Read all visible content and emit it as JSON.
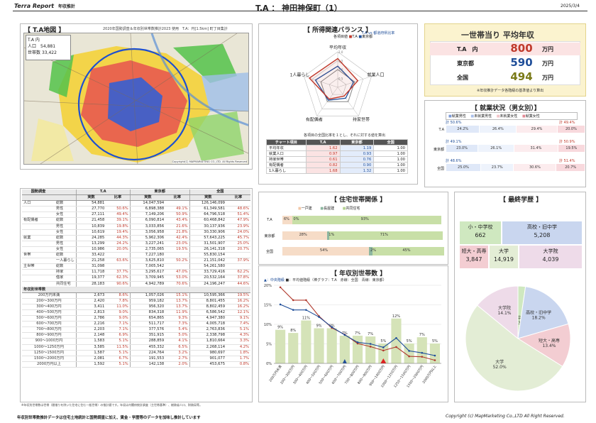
{
  "header": {
    "brand": "Terra Report",
    "brand_sub": "年収推計",
    "title": "T.A ： 神田神保町（1）",
    "date": "2025/3/4"
  },
  "map": {
    "title": "【 T.A地図 】",
    "source": "2020年国勢調査＆年収別世帯数推計2023 使用　T.A：円[1.5km] 町丁目集計",
    "info_title": "T.A 内",
    "pop_label": "人口",
    "pop_value": "54,881",
    "hh_label": "世帯数",
    "hh_value": "33,422",
    "copyright": "Copyright(C) MAPMARKETING CO.,LTD. All Rights Reserved"
  },
  "stats": {
    "head": [
      "国勢調査",
      "T.A",
      "東京都",
      "全国"
    ],
    "sub": [
      "実数",
      "比率",
      "実数",
      "比率",
      "実数",
      "比率"
    ],
    "rows": [
      [
        "人口",
        "総数",
        "54,881",
        "",
        "14,047,594",
        "",
        "126,146,099",
        ""
      ],
      [
        "",
        "男性",
        "27,770",
        "50.6%",
        "6,898,388",
        "49.1%",
        "61,349,581",
        "48.6%"
      ],
      [
        "",
        "女性",
        "27,111",
        "49.4%",
        "7,149,206",
        "50.9%",
        "64,796,518",
        "51.4%"
      ],
      [
        "有配偶者",
        "総数",
        "21,458",
        "39.1%",
        "6,090,814",
        "43.4%",
        "60,468,842",
        "47.9%"
      ],
      [
        "",
        "男性",
        "10,839",
        "19.8%",
        "3,033,856",
        "21.6%",
        "30,137,936",
        "23.9%"
      ],
      [
        "",
        "女性",
        "10,619",
        "19.4%",
        "3,056,958",
        "21.8%",
        "30,330,906",
        "24.0%"
      ],
      [
        "就業",
        "総数",
        "24,285",
        "44.3%",
        "5,962,306",
        "42.4%",
        "57,643,225",
        "45.7%"
      ],
      [
        "",
        "男性",
        "13,299",
        "24.2%",
        "3,227,241",
        "23.0%",
        "31,501,907",
        "25.0%"
      ],
      [
        "",
        "女性",
        "10,986",
        "20.0%",
        "2,735,065",
        "19.5%",
        "26,141,318",
        "20.7%"
      ],
      [
        "世帯",
        "総数",
        "33,422",
        "",
        "7,227,180",
        "",
        "55,830,154",
        ""
      ],
      [
        "",
        "一人暮らし",
        "21,258",
        "63.6%",
        "3,625,810",
        "50.2%",
        "21,151,042",
        "37.9%"
      ],
      [
        "主世帯",
        "総数",
        "31,098",
        "",
        "7,005,542",
        "",
        "54,261,580",
        ""
      ],
      [
        "",
        "持家",
        "11,718",
        "37.7%",
        "3,295,617",
        "47.0%",
        "33,729,416",
        "62.2%"
      ],
      [
        "",
        "借家",
        "19,377",
        "62.3%",
        "3,709,945",
        "53.0%",
        "20,532,164",
        "37.8%"
      ],
      [
        "",
        "共同住宅",
        "28,183",
        "90.6%",
        "4,942,789",
        "70.6%",
        "24,196,247",
        "44.6%"
      ]
    ],
    "income_head": "年収別世帯数",
    "income": [
      [
        "200万円未満",
        "2,673",
        "8.6%",
        "1,057,026",
        "15.1%",
        "10,595,366",
        "19.5%"
      ],
      [
        "200〜300万円",
        "2,420",
        "7.8%",
        "959,182",
        "13.7%",
        "8,801,455",
        "16.2%"
      ],
      [
        "300〜400万円",
        "3,411",
        "11.0%",
        "956,320",
        "13.7%",
        "8,802,459",
        "16.2%"
      ],
      [
        "400〜500万円",
        "2,813",
        "9.0%",
        "834,318",
        "11.9%",
        "6,586,542",
        "12.1%"
      ],
      [
        "500〜600万円",
        "2,786",
        "9.0%",
        "654,865",
        "9.3%",
        "4,947,380",
        "9.1%"
      ],
      [
        "600〜700万円",
        "2,216",
        "7.1%",
        "511,717",
        "7.3%",
        "4,005,718",
        "7.4%"
      ],
      [
        "700〜800万円",
        "2,203",
        "7.1%",
        "377,576",
        "5.4%",
        "2,763,836",
        "5.1%"
      ],
      [
        "800〜900万円",
        "2,148",
        "6.9%",
        "351,915",
        "5.0%",
        "2,338,798",
        "4.3%"
      ],
      [
        "900〜1000万円",
        "1,583",
        "5.1%",
        "288,859",
        "4.1%",
        "1,810,664",
        "3.3%"
      ],
      [
        "1000〜1250万円",
        "3,585",
        "11.5%",
        "455,332",
        "6.5%",
        "2,268,114",
        "4.2%"
      ],
      [
        "1250〜1500万円",
        "1,587",
        "5.1%",
        "224,764",
        "3.2%",
        "980,697",
        "1.8%"
      ],
      [
        "1500〜2000万円",
        "2,081",
        "6.7%",
        "191,553",
        "2.7%",
        "901,077",
        "1.7%"
      ],
      [
        "2000万円以上",
        "1,592",
        "5.1%",
        "142,138",
        "2.0%",
        "453,675",
        "0.8%"
      ]
    ],
    "footnote": "※年収別世帯数は世帯（間借りを除いた住宅に住む一般世帯）の推計値です。年収は内閣府統計調査（主世帯基準）、総務省人口、財務局等。"
  },
  "radar": {
    "title": "【 所得関連バランス 】",
    "legend": [
      "各項目値",
      "T.A",
      "東京都",
      "全国"
    ],
    "legend_note": "T.A vs 都道府県比率",
    "axes": [
      "平均年収",
      "就業人口",
      "持家世帯",
      "有配偶者",
      "1人暮らし"
    ],
    "ta": [
      1.62,
      1.19,
      0.61,
      0.82,
      1.68
    ],
    "tokyo": [
      1.19,
      0.93,
      0.76,
      0.9,
      1.32
    ],
    "note": "各項目の全国比率を１とし、それに対する値を算出",
    "table_head": [
      "チャート項目",
      "T.A",
      "東京都",
      "全国"
    ],
    "table": [
      [
        "平均年収",
        "1.62",
        "1.19",
        "1.00"
      ],
      [
        "就業人口",
        "0.97",
        "0.93",
        "1.00"
      ],
      [
        "持家世帯",
        "0.61",
        "0.76",
        "1.00"
      ],
      [
        "有配偶者",
        "0.82",
        "0.90",
        "1.00"
      ],
      [
        "1人暮らし",
        "1.68",
        "1.32",
        "1.00"
      ]
    ]
  },
  "avg_income": {
    "title": "一世帯当り 平均年収",
    "rows": [
      {
        "label": "T.A　内",
        "value": "800",
        "unit": "万円"
      },
      {
        "label": "東京都",
        "value": "590",
        "unit": "万円"
      },
      {
        "label": "全国",
        "value": "494",
        "unit": "万円"
      }
    ],
    "note": "※年収推計データ各階級の基準値より算出",
    "colors": [
      "#c0392b",
      "#1f4e99",
      "#7a7a18"
    ]
  },
  "employment": {
    "title": "【 就業状況（男女別）】",
    "legend": [
      "就業男性",
      "未就業男性",
      "未就業女性",
      "就業女性"
    ],
    "rows": [
      {
        "name": "T.A",
        "top": "計 50.6%",
        "right": "計 49.4%",
        "vals": [
          24.2,
          26.4,
          29.4,
          20.0
        ]
      },
      {
        "name": "東京都",
        "top": "計 49.1%",
        "right": "計 50.9%",
        "vals": [
          23.0,
          26.1,
          31.4,
          19.5
        ]
      },
      {
        "name": "全国",
        "top": "計 48.6%",
        "right": "計 51.4%",
        "vals": [
          25.0,
          23.7,
          30.6,
          20.7
        ]
      }
    ],
    "labels": [
      [
        "24.2%",
        "26.4%",
        "29.4%",
        "20.0%"
      ],
      [
        "23.0%",
        "26.1%",
        "31.4%",
        "19.5%"
      ],
      [
        "25.0%",
        "23.7%",
        "30.6%",
        "20.7%"
      ]
    ]
  },
  "housing": {
    "title": "【 住宅世帯関係 】",
    "legend": [
      "一戸建",
      "長屋建",
      "共同住宅"
    ],
    "rows": [
      {
        "name": "T.A",
        "vals": [
          6,
          0,
          93
        ],
        "labels": [
          "6%",
          "0%",
          "93%"
        ]
      },
      {
        "name": "東京都",
        "vals": [
          28,
          1,
          71
        ],
        "labels": [
          "28%",
          "1%",
          "71%"
        ]
      },
      {
        "name": "全国",
        "vals": [
          54,
          2,
          45
        ],
        "labels": [
          "54%",
          "2%",
          "45%"
        ]
      }
    ]
  },
  "income_chart": {
    "title": "【 年収別世帯数 】",
    "legend": [
      "▲：中央階級",
      "■：平均値階級（棒グラフ：T.A　赤線：全国　青線：東京都）"
    ],
    "categories": [
      "200万円未満",
      "200〜300万円",
      "300〜400万円",
      "400〜500万円",
      "500〜600万円",
      "600〜700万円",
      "700〜800万円",
      "800〜900万円",
      "900〜1000万円",
      "1000〜1250万円",
      "1250〜1500万円",
      "1500〜2000万円",
      "2000万円以上"
    ],
    "ta": [
      8.6,
      7.8,
      11.0,
      9.0,
      9.0,
      7.1,
      7.1,
      6.9,
      5.1,
      11.5,
      5.1,
      6.7,
      5.1
    ],
    "zenkoku": [
      19.5,
      16.2,
      16.2,
      12.1,
      9.1,
      7.4,
      5.1,
      4.3,
      3.3,
      4.2,
      1.8,
      1.7,
      0.8
    ],
    "tokyo": [
      15.1,
      13.7,
      13.7,
      11.9,
      9.3,
      7.3,
      5.4,
      5.0,
      4.1,
      6.5,
      3.2,
      2.7,
      2.0
    ],
    "bar_labels": [
      "9%",
      "8%",
      "11%",
      "9%",
      "9%",
      "7%",
      "7%",
      "7%",
      "5%",
      "12%",
      "5%",
      "7%",
      "5%"
    ],
    "yticks": [
      "0%",
      "5%",
      "10%",
      "15%",
      "20%"
    ],
    "ymax": 20,
    "median_index": 5,
    "mean_index": 8
  },
  "education": {
    "title": "【 最終学歴 】",
    "cells": [
      [
        "小・中学校",
        "662"
      ],
      [
        "高校・旧中学",
        "5,208"
      ],
      [
        "短大・高専",
        "3,847"
      ],
      [
        "大学",
        "14,919"
      ],
      [
        "大学院",
        "4,039"
      ]
    ],
    "pie": [
      {
        "name": "小・中学校",
        "pct": "2.3%",
        "value": 2.3,
        "color": "#cfe8c0"
      },
      {
        "name": "高校・旧中学",
        "pct": "18.2%",
        "value": 18.2,
        "color": "#c9d6ef"
      },
      {
        "name": "短大・高専",
        "pct": "13.4%",
        "value": 13.4,
        "color": "#f3cdd2"
      },
      {
        "name": "大学",
        "pct": "52.0%",
        "value": 52.0,
        "color": "#e3edd5"
      },
      {
        "name": "大学院",
        "pct": "14.1%",
        "value": 14.1,
        "color": "#eedbe9"
      }
    ]
  },
  "footer": {
    "left": "年収別世帯数推計データは住宅土地統計と国勢調査に加え、賃金・学歴等のデータを加味し推計しています",
    "right": "Copyright (c) MapMarketing Co.,LTD All Right Reserved."
  }
}
